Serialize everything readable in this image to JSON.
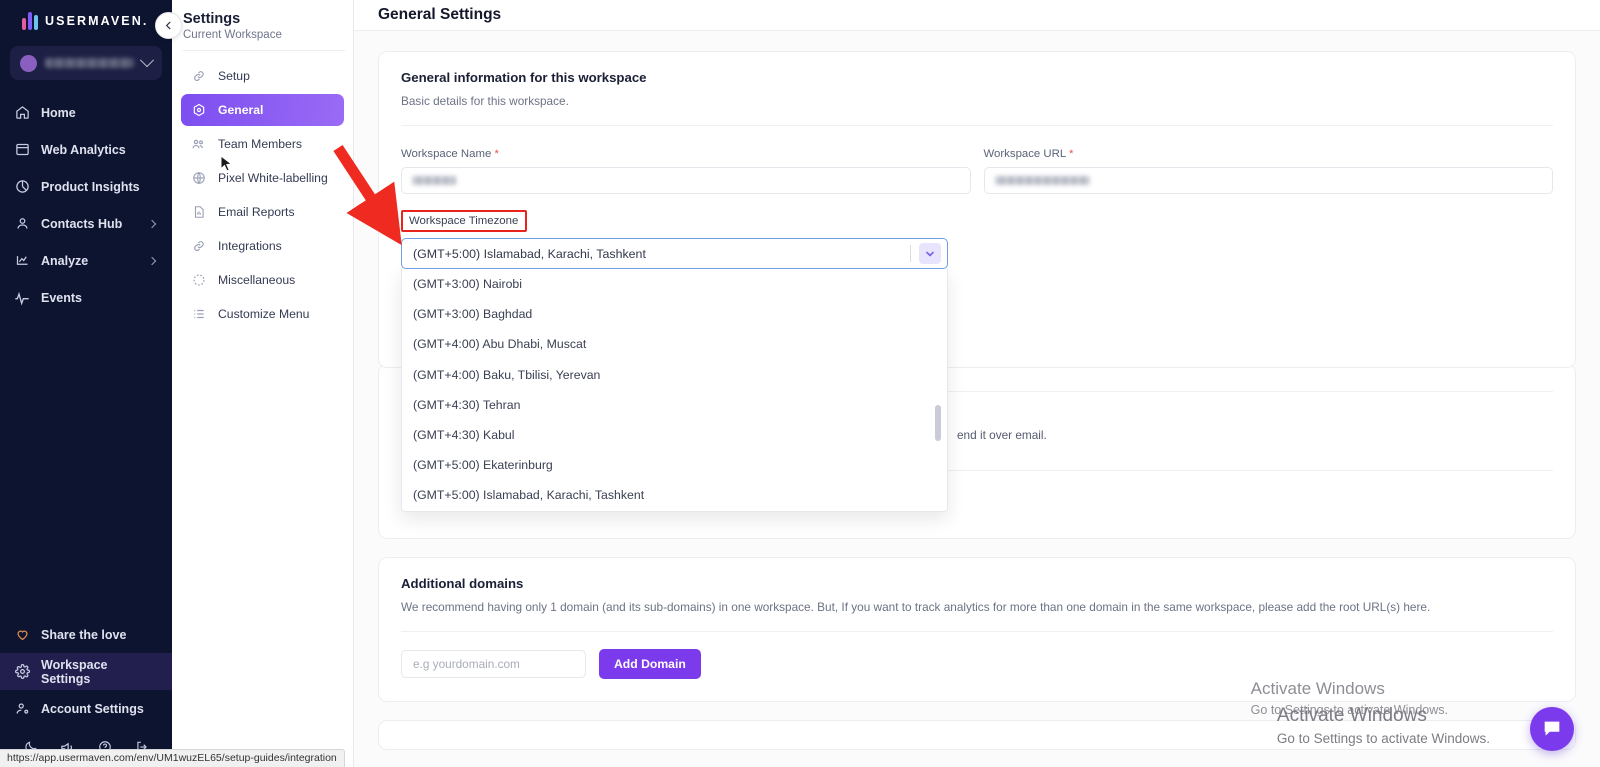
{
  "brand": {
    "name": "USERMAVEN."
  },
  "workspace_selector": {
    "name_redacted": true
  },
  "nav": {
    "items": [
      {
        "label": "Home",
        "icon": "home-icon",
        "has_caret": false
      },
      {
        "label": "Web Analytics",
        "icon": "window-icon",
        "has_caret": false
      },
      {
        "label": "Product Insights",
        "icon": "pie-chart-icon",
        "has_caret": false
      },
      {
        "label": "Contacts Hub",
        "icon": "user-icon",
        "has_caret": true
      },
      {
        "label": "Analyze",
        "icon": "chart-icon",
        "has_caret": true
      },
      {
        "label": "Events",
        "icon": "activity-icon",
        "has_caret": false
      }
    ],
    "bottom_items": [
      {
        "label": "Share the love",
        "icon": "heart-icon",
        "active": false
      },
      {
        "label": "Workspace Settings",
        "icon": "gear-icon",
        "active": true
      },
      {
        "label": "Account Settings",
        "icon": "user-settings-icon",
        "active": false
      }
    ],
    "utility_icons": [
      "moon-icon",
      "megaphone-icon",
      "help-circle-icon",
      "logout-icon"
    ]
  },
  "statusbar": {
    "url": "https://app.usermaven.com/env/UM1wuzEL65/setup-guides/integration"
  },
  "settings_panel": {
    "title": "Settings",
    "subtitle": "Current Workspace",
    "items": [
      {
        "label": "Setup",
        "icon": "link-icon",
        "selected": false
      },
      {
        "label": "General",
        "icon": "settings-dot-icon",
        "selected": true
      },
      {
        "label": "Team Members",
        "icon": "users-icon",
        "selected": false
      },
      {
        "label": "Pixel White-labelling",
        "icon": "globe-icon",
        "selected": false
      },
      {
        "label": "Email Reports",
        "icon": "report-icon",
        "selected": false
      },
      {
        "label": "Integrations",
        "icon": "link-icon",
        "selected": false
      },
      {
        "label": "Miscellaneous",
        "icon": "dashed-circle-icon",
        "selected": false
      },
      {
        "label": "Customize Menu",
        "icon": "list-icon",
        "selected": false
      }
    ]
  },
  "page": {
    "title": "General Settings"
  },
  "general_card": {
    "heading": "General information for this workspace",
    "subheading": "Basic details for this workspace.",
    "workspace_name": {
      "label": "Workspace Name",
      "required_mark": "*",
      "value_redacted": true
    },
    "workspace_url": {
      "label": "Workspace URL",
      "required_mark": "*",
      "value_redacted": true
    },
    "timezone": {
      "label": "Workspace Timezone",
      "selected": "(GMT+5:00) Islamabad, Karachi, Tashkent",
      "open": true,
      "options": [
        "(GMT+3:00) Nairobi",
        "(GMT+3:00) Baghdad",
        "(GMT+4:00) Abu Dhabi, Muscat",
        "(GMT+4:00) Baku, Tbilisi, Yerevan",
        "(GMT+4:30) Tehran",
        "(GMT+4:30) Kabul",
        "(GMT+5:00) Ekaterinburg",
        "(GMT+5:00) Islamabad, Karachi, Tashkent"
      ]
    }
  },
  "hidden_card": {
    "partial_text": "end it over email."
  },
  "domains_card": {
    "heading": "Additional domains",
    "description": "We recommend having only 1 domain (and its sub-domains) in one workspace. But, If you want to track analytics for more than one domain in the same workspace, please add the root URL(s) here.",
    "input_placeholder": "e.g yourdomain.com",
    "add_button": "Add Domain"
  },
  "watermark": {
    "title": "Activate Windows",
    "subtitle": "Go to Settings to activate Windows."
  },
  "colors": {
    "accent_purple": "#7c3aed",
    "sidebar_dark": "#0c1430",
    "annotation_red": "#e8241c",
    "focus_blue": "#6e9fe6"
  }
}
